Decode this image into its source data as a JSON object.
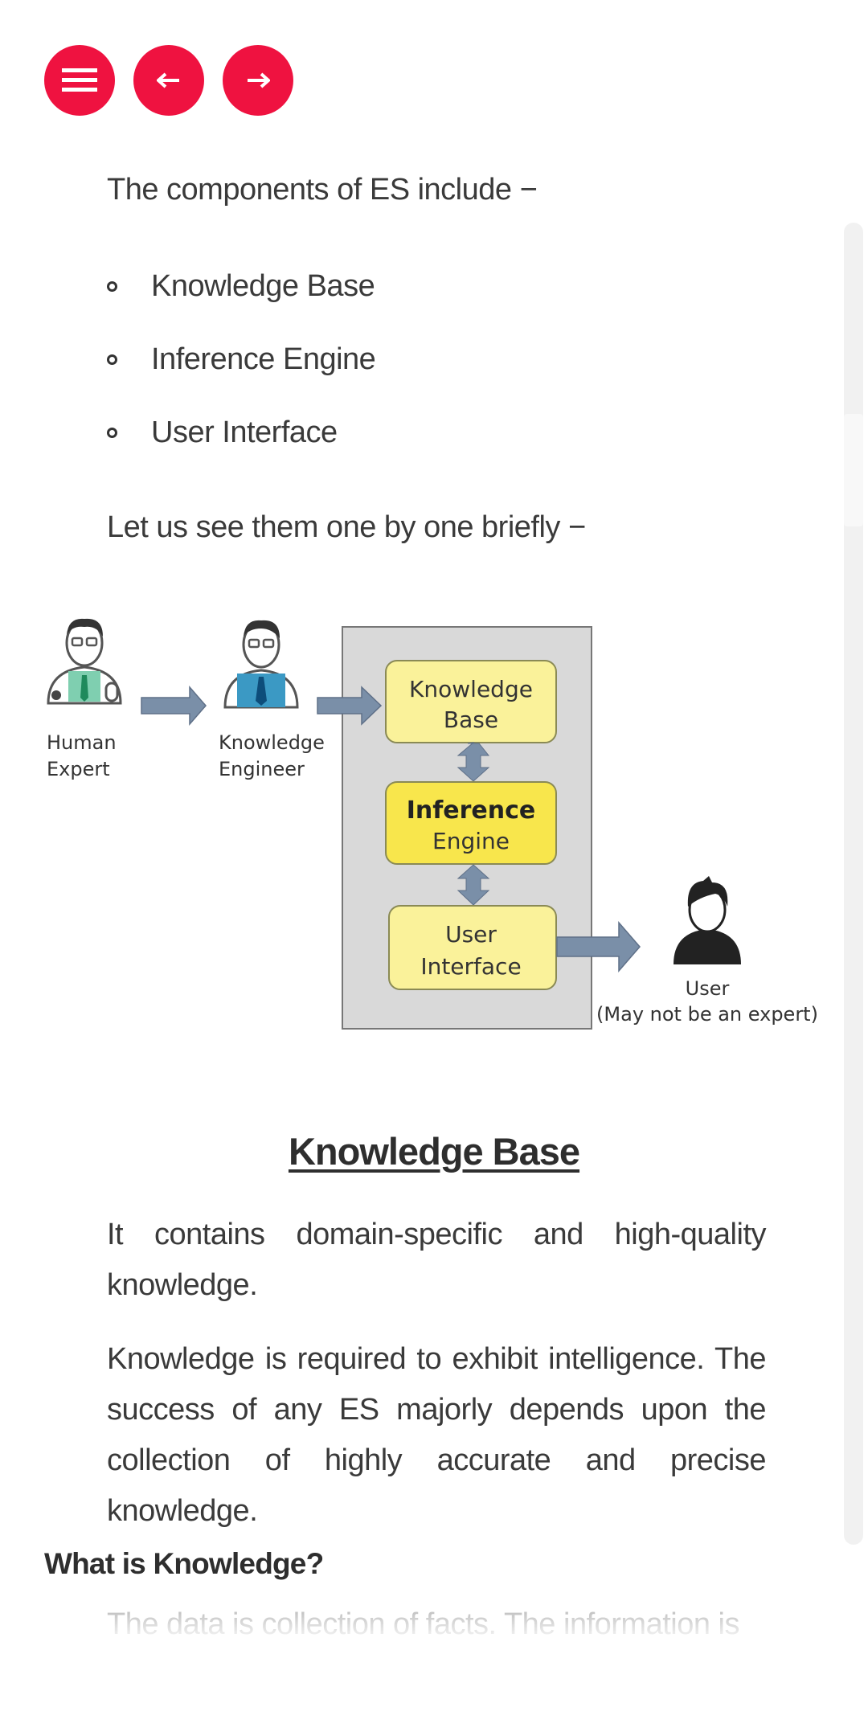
{
  "nav": {
    "menu_icon": "hamburger-menu-icon",
    "prev_icon": "arrow-left-icon",
    "next_icon": "arrow-right-icon",
    "accent_color": "#ef1240"
  },
  "content": {
    "intro": "The components of ES include −",
    "components": [
      {
        "label": "Knowledge Base"
      },
      {
        "label": "Inference Engine"
      },
      {
        "label": "User Interface"
      }
    ],
    "lead": "Let us see them one by one briefly −",
    "diagram": {
      "human_expert": [
        "Human",
        "Expert"
      ],
      "knowledge_engineer": [
        "Knowledge",
        "Engineer"
      ],
      "knowledge_base": [
        "Knowledge",
        "Base"
      ],
      "inference_engine": [
        "Inference",
        "Engine"
      ],
      "user_interface": [
        "User",
        "Interface"
      ],
      "user": [
        "User",
        "(May not be an expert)"
      ]
    },
    "section_title": "Knowledge Base",
    "para1": "It contains domain-specific and high-quality knowledge.",
    "para2": "Knowledge is required to exhibit intelligence. The success of any ES majorly depends upon the collection of highly accurate and precise knowledge.",
    "subheading": "What is Knowledge?",
    "para3": "The data is collection of facts. The information is"
  }
}
